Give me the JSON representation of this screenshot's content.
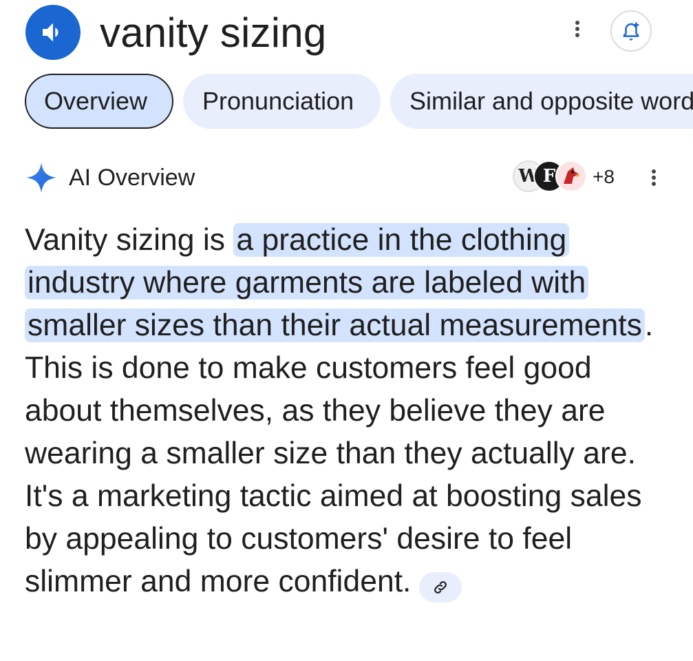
{
  "header": {
    "title": "vanity sizing",
    "speaker_icon": "volume-up-icon",
    "more_icon": "more-vert-icon",
    "subscribe_icon": "bell-add-icon"
  },
  "tabs": [
    {
      "label": "Overview",
      "active": true
    },
    {
      "label": "Pronunciation",
      "active": false
    },
    {
      "label": "Similar and opposite words",
      "active": false
    }
  ],
  "ai_overview": {
    "label": "AI Overview",
    "sparkle_icon": "sparkle-icon",
    "sources": [
      "W",
      "F",
      "cardinal"
    ],
    "more_sources": "+8",
    "menu_icon": "more-vert-icon",
    "text_intro": "Vanity sizing is ",
    "text_highlighted": "a practice in the clothing industry where garments are labeled with smaller sizes than their actual measurements",
    "text_rest": ". This is done to make customers feel good about themselves, as they believe they are wearing a smaller size than they actually are. It's a marketing tactic aimed at boosting sales by appealing to customers' desire to feel slimmer and more confident.",
    "link_icon": "link-icon"
  },
  "colors": {
    "brand_blue": "#1a67d2",
    "highlight": "#d3e3fd",
    "chip": "#e8eefc"
  }
}
